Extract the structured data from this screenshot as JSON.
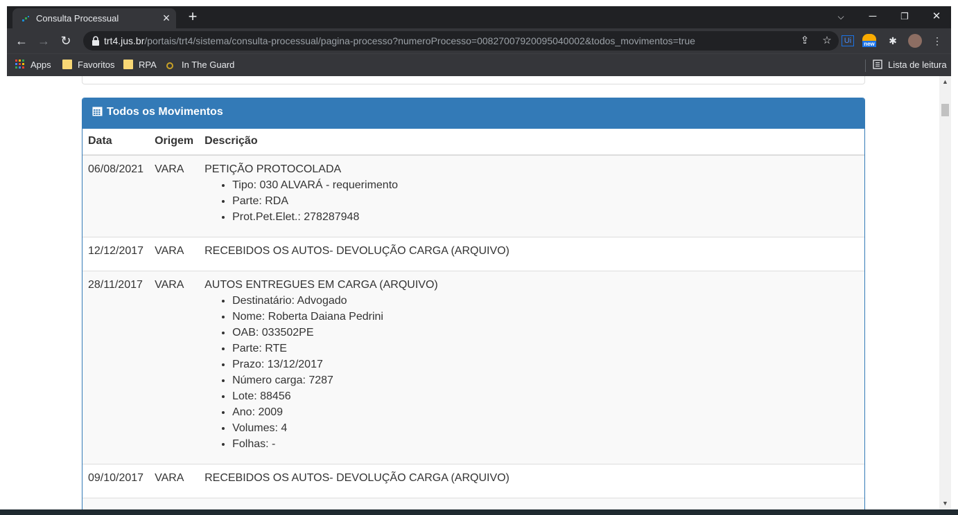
{
  "browser": {
    "tab_title": "Consulta Processual",
    "url_host": "trt4.jus.br",
    "url_path": "/portais/trt4/sistema/consulta-processual/pagina-processo?numeroProcesso=00827007920095040002&todos_movimentos=true",
    "bookmarks": [
      "Apps",
      "Favoritos",
      "RPA",
      "In The Guard"
    ],
    "reading_list": "Lista de leitura",
    "ext_badge": "new"
  },
  "panel": {
    "title": "Todos os Movimentos",
    "columns": [
      "Data",
      "Origem",
      "Descrição"
    ]
  },
  "movements": [
    {
      "date": "06/08/2021",
      "origin": "VARA",
      "description": "PETIÇÃO PROTOCOLADA",
      "details": [
        "Tipo: 030 ALVARÁ - requerimento",
        "Parte: RDA",
        "Prot.Pet.Elet.: 278287948"
      ]
    },
    {
      "date": "12/12/2017",
      "origin": "VARA",
      "description": "RECEBIDOS OS AUTOS- DEVOLUÇÃO CARGA (ARQUIVO)",
      "details": []
    },
    {
      "date": "28/11/2017",
      "origin": "VARA",
      "description": "AUTOS ENTREGUES EM CARGA (ARQUIVO)",
      "details": [
        "Destinatário: Advogado",
        "Nome: Roberta Daiana Pedrini",
        "OAB: 033502PE",
        "Parte: RTE",
        "Prazo: 13/12/2017",
        "Número carga: 7287",
        "Lote: 88456",
        "Ano: 2009",
        "Volumes: 4",
        "Folhas: -"
      ]
    },
    {
      "date": "09/10/2017",
      "origin": "VARA",
      "description": "RECEBIDOS OS AUTOS- DEVOLUÇÃO CARGA (ARQUIVO)",
      "details": []
    }
  ],
  "colors": {
    "chrome_dark": "#202124",
    "chrome_toolbar": "#35363a",
    "panel_primary": "#337ab7",
    "row_striped": "#f9f9f9"
  }
}
